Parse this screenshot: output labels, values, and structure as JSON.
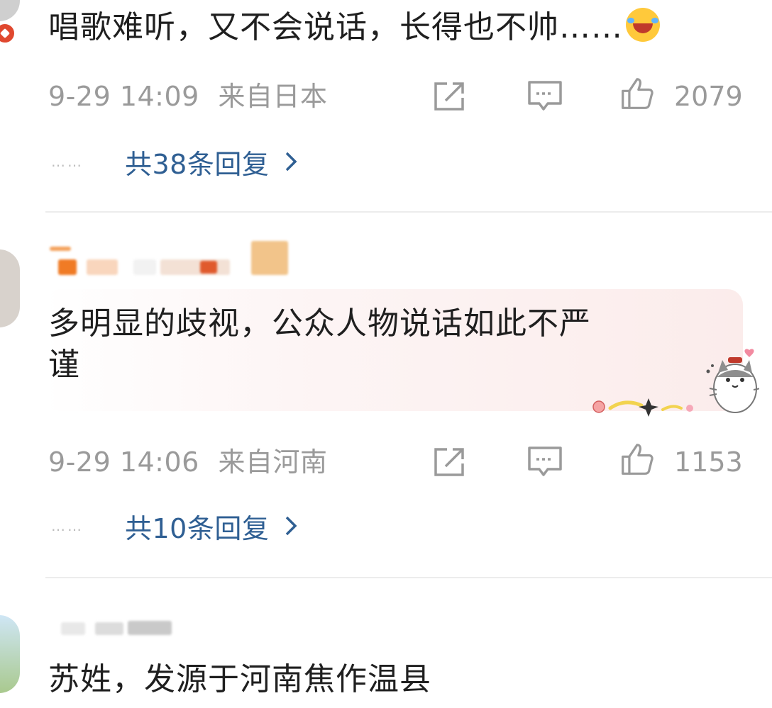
{
  "comments": [
    {
      "text": "唱歌难听，又不会说话，长得也不帅……",
      "emoji": "grinning-tears-emoji",
      "time": "9-29 14:09",
      "location": "来自日本",
      "likes": "2079",
      "replies_label": "共38条回复",
      "replies_dots": "……"
    },
    {
      "text_line1": "多明显的歧视，公众人物说话如此不严",
      "text_line2": "谨",
      "time": "9-29 14:06",
      "location": "来自河南",
      "likes": "1153",
      "replies_label": "共10条回复",
      "replies_dots": "……"
    },
    {
      "text": "苏姓，发源于河南焦作温县"
    }
  ],
  "icons": {
    "share": "share-icon",
    "comment": "comment-icon",
    "like": "thumbs-up-icon",
    "chevron": "chevron-right-icon"
  },
  "colors": {
    "link": "#2f5f93",
    "meta": "#9a9a9a",
    "text": "#1f1f1f",
    "badge": "#e0482f"
  }
}
